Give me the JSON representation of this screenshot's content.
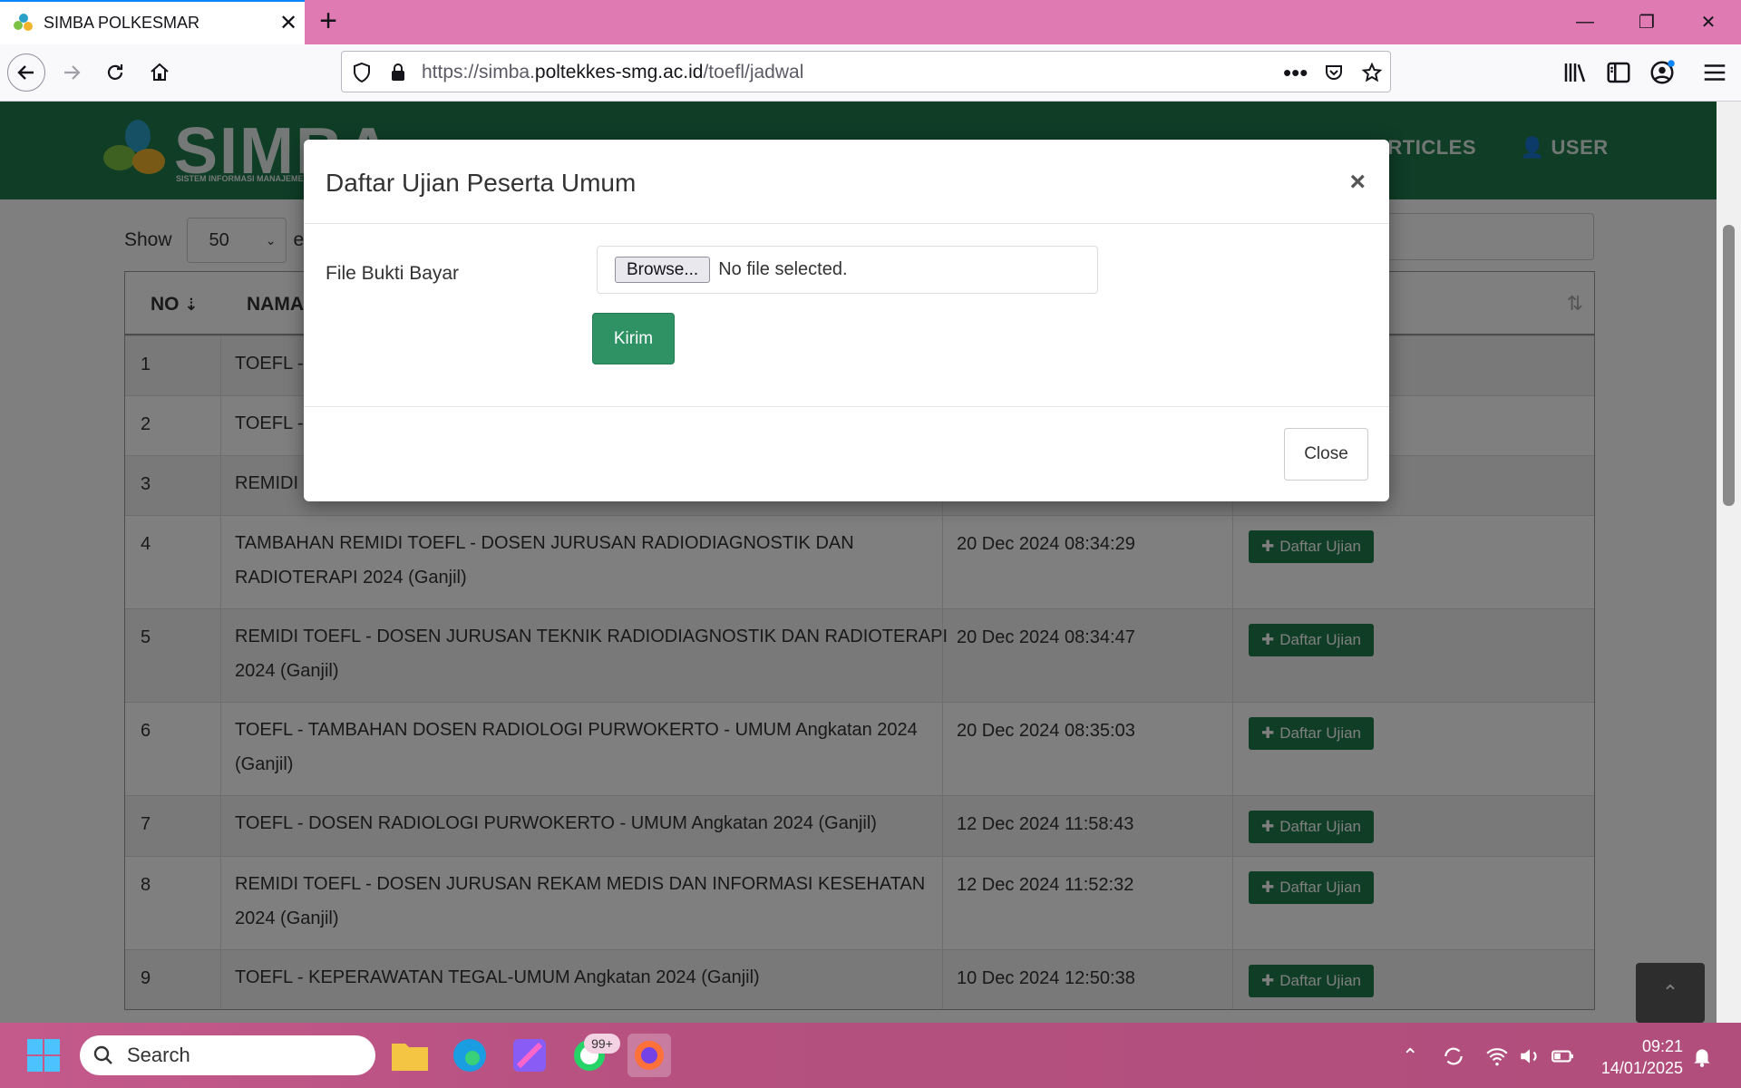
{
  "browser": {
    "tab_title": "SIMBA POLKESMAR",
    "url_prefix": "https://simba.",
    "url_domain": "poltekkes-smg.ac.id",
    "url_path": "/toefl/jadwal"
  },
  "site": {
    "logo_text": "SIMBA",
    "logo_subtitle": "SISTEM INFORMASI MANAJEMEN BA",
    "menu": [
      "ARTICLES",
      "USER"
    ]
  },
  "table_controls": {
    "show_label": "Show",
    "show_value": "50",
    "entries_label": "en"
  },
  "table": {
    "headers": {
      "no": "NO",
      "nama": "NAMA"
    },
    "rows": [
      {
        "no": "1",
        "name": "TOEFL -",
        "date": "",
        "action": ""
      },
      {
        "no": "2",
        "name": "TOEFL -",
        "date": "",
        "action": ""
      },
      {
        "no": "3",
        "name": "REMIDI",
        "date": "",
        "action": ""
      },
      {
        "no": "4",
        "name": "TAMBAHAN REMIDI TOEFL - DOSEN JURUSAN RADIODIAGNOSTIK DAN RADIOTERAPI 2024 (Ganjil)",
        "date": "20 Dec 2024 08:34:29",
        "action": "Daftar Ujian"
      },
      {
        "no": "5",
        "name": "REMIDI TOEFL - DOSEN JURUSAN TEKNIK RADIODIAGNOSTIK DAN RADIOTERAPI 2024 (Ganjil)",
        "date": "20 Dec 2024 08:34:47",
        "action": "Daftar Ujian"
      },
      {
        "no": "6",
        "name": "TOEFL - TAMBAHAN DOSEN RADIOLOGI PURWOKERTO - UMUM Angkatan 2024 (Ganjil)",
        "date": "20 Dec 2024 08:35:03",
        "action": "Daftar Ujian"
      },
      {
        "no": "7",
        "name": "TOEFL - DOSEN RADIOLOGI PURWOKERTO - UMUM Angkatan 2024 (Ganjil)",
        "date": "12 Dec 2024 11:58:43",
        "action": "Daftar Ujian"
      },
      {
        "no": "8",
        "name": "REMIDI TOEFL - DOSEN JURUSAN REKAM MEDIS DAN INFORMASI KESEHATAN 2024 (Ganjil)",
        "date": "12 Dec 2024 11:52:32",
        "action": "Daftar Ujian"
      },
      {
        "no": "9",
        "name": "TOEFL - KEPERAWATAN TEGAL-UMUM Angkatan 2024 (Ganjil)",
        "date": "10 Dec 2024 12:50:38",
        "action": "Daftar Ujian"
      }
    ]
  },
  "modal": {
    "title": "Daftar Ujian Peserta Umum",
    "field_label": "File Bukti Bayar",
    "browse_label": "Browse...",
    "file_status": "No file selected.",
    "submit_label": "Kirim",
    "close_label": "Close"
  },
  "taskbar": {
    "search_placeholder": "Search",
    "badge": "99+",
    "time": "09:21",
    "date": "14/01/2025"
  },
  "colors": {
    "header_green": "#1f7a4d",
    "button_green": "#2e9265",
    "tabstrip_pink": "#e07ab3"
  }
}
